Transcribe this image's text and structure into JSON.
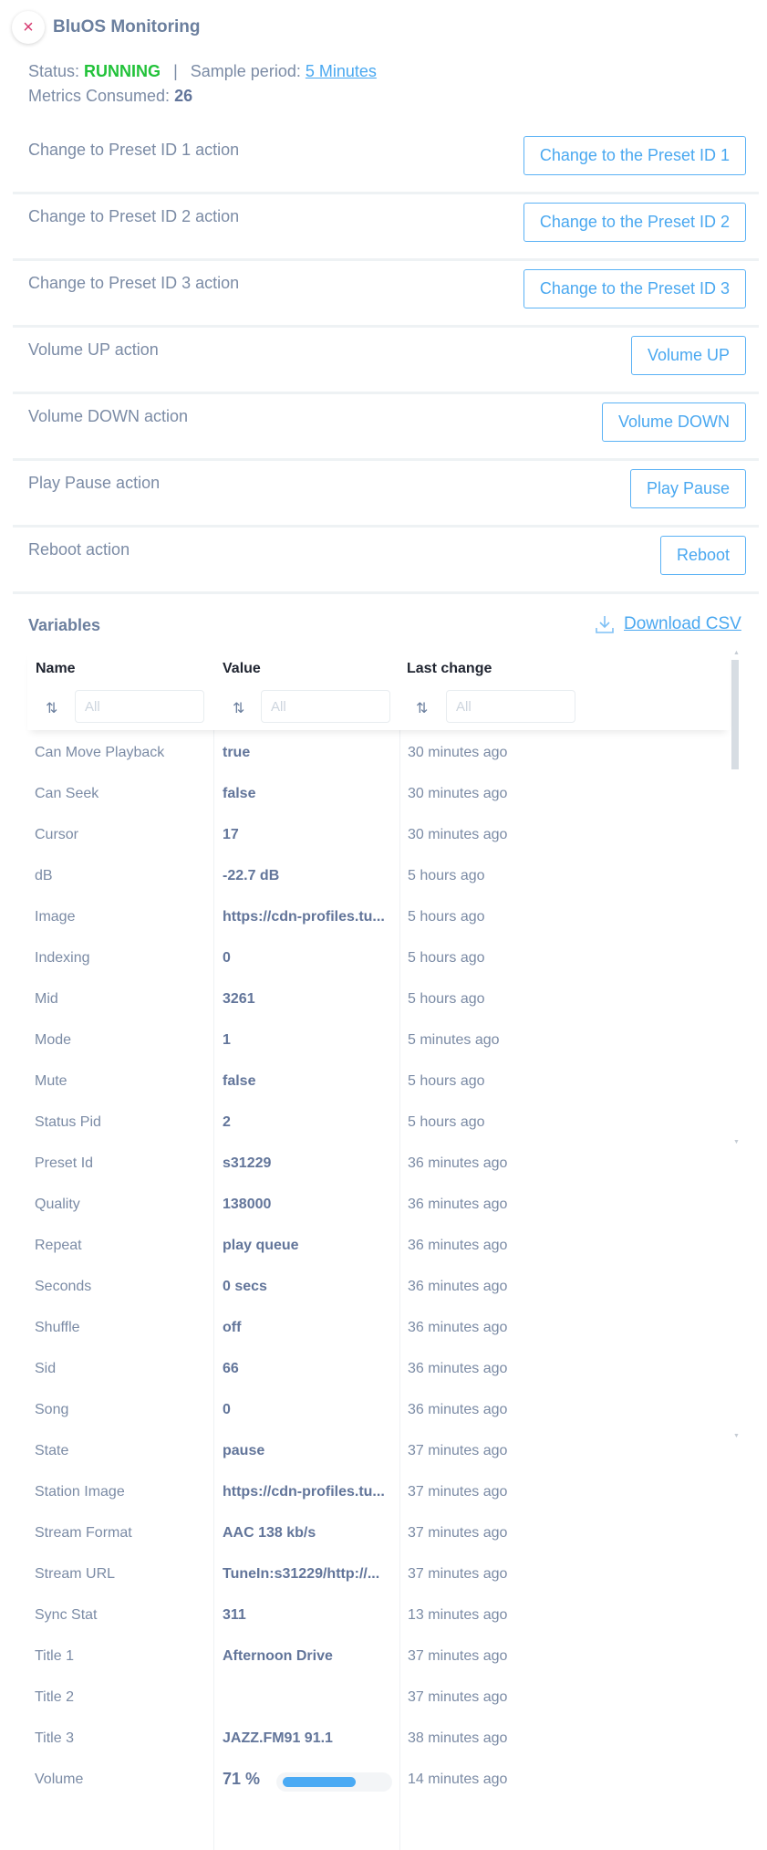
{
  "header": {
    "close_icon": "×",
    "title": "BluOS Monitoring"
  },
  "status": {
    "status_label": "Status:",
    "status_value": "RUNNING",
    "separator": "|",
    "sample_label": "Sample period:",
    "sample_value": "5 Minutes",
    "metrics_label": "Metrics Consumed:",
    "metrics_value": "26"
  },
  "colors": {
    "accent": "#4aa8f0",
    "running": "#22c23a",
    "close": "#d6386f",
    "text": "#6b7f9e"
  },
  "actions": [
    {
      "label": "Change to Preset ID 1 action",
      "button": "Change to the Preset ID 1"
    },
    {
      "label": "Change to Preset ID 2 action",
      "button": "Change to the Preset ID 2"
    },
    {
      "label": "Change to Preset ID 3 action",
      "button": "Change to the Preset ID 3"
    },
    {
      "label": "Volume UP action",
      "button": "Volume UP"
    },
    {
      "label": "Volume DOWN action",
      "button": "Volume DOWN"
    },
    {
      "label": "Play Pause action",
      "button": "Play Pause"
    },
    {
      "label": "Reboot action",
      "button": "Reboot"
    }
  ],
  "variables": {
    "title": "Variables",
    "download_label": "Download CSV",
    "download_icon": "download-icon",
    "columns": [
      {
        "label": "Name",
        "filter_placeholder": "All"
      },
      {
        "label": "Value",
        "filter_placeholder": "All"
      },
      {
        "label": "Last change",
        "filter_placeholder": "All"
      }
    ],
    "sort_icon": "⇅",
    "rows": [
      {
        "name": "Can Move Playback",
        "value": "true",
        "changed": "30 minutes ago"
      },
      {
        "name": "Can Seek",
        "value": "false",
        "changed": "30 minutes ago"
      },
      {
        "name": "Cursor",
        "value": "17",
        "changed": "30 minutes ago"
      },
      {
        "name": "dB",
        "value": "-22.7 dB",
        "changed": "5 hours ago"
      },
      {
        "name": "Image",
        "value": "https://cdn-profiles.tu...",
        "changed": "5 hours ago"
      },
      {
        "name": "Indexing",
        "value": "0",
        "changed": "5 hours ago"
      },
      {
        "name": "Mid",
        "value": "3261",
        "changed": "5 hours ago"
      },
      {
        "name": "Mode",
        "value": "1",
        "changed": "5 minutes ago"
      },
      {
        "name": "Mute",
        "value": "false",
        "changed": "5 hours ago"
      },
      {
        "name": "Status Pid",
        "value": "2",
        "changed": "5 hours ago"
      },
      {
        "name": "Preset Id",
        "value": "s31229",
        "changed": "36 minutes ago"
      },
      {
        "name": "Quality",
        "value": "138000",
        "changed": "36 minutes ago"
      },
      {
        "name": "Repeat",
        "value": "play queue",
        "changed": "36 minutes ago"
      },
      {
        "name": "Seconds",
        "value": "0 secs",
        "changed": "36 minutes ago"
      },
      {
        "name": "Shuffle",
        "value": "off",
        "changed": "36 minutes ago"
      },
      {
        "name": "Sid",
        "value": "66",
        "changed": "36 minutes ago"
      },
      {
        "name": "Song",
        "value": "0",
        "changed": "36 minutes ago"
      },
      {
        "name": "State",
        "value": "pause",
        "changed": "37 minutes ago"
      },
      {
        "name": "Station Image",
        "value": "https://cdn-profiles.tu...",
        "changed": "37 minutes ago"
      },
      {
        "name": "Stream Format",
        "value": "AAC 138 kb/s",
        "changed": "37 minutes ago"
      },
      {
        "name": "Stream URL",
        "value": "TuneIn:s31229/http://...",
        "changed": "37 minutes ago"
      },
      {
        "name": "Sync Stat",
        "value": "311",
        "changed": "13 minutes ago"
      },
      {
        "name": "Title 1",
        "value": "Afternoon Drive",
        "changed": "37 minutes ago"
      },
      {
        "name": "Title 2",
        "value": "",
        "changed": "37 minutes ago"
      },
      {
        "name": "Title 3",
        "value": "JAZZ.FM91 91.1",
        "changed": "38 minutes ago"
      },
      {
        "name": "Volume",
        "value": "71 %",
        "changed": "14 minutes ago",
        "progress_percent": 71
      }
    ]
  }
}
